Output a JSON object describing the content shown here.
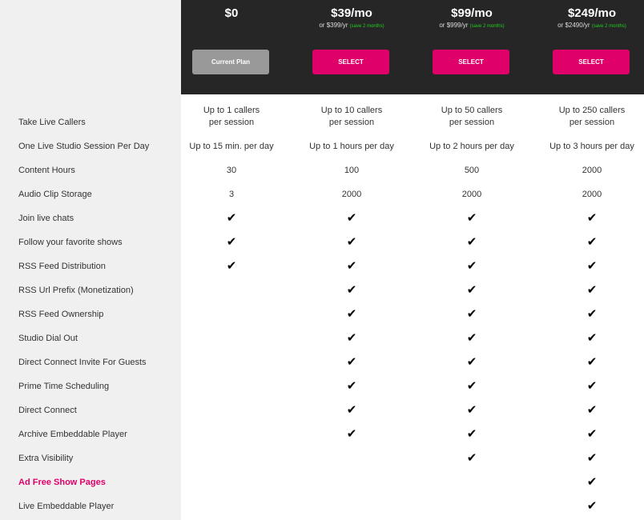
{
  "plans": [
    {
      "price": "$0",
      "yearly": "",
      "save": "",
      "button": "Current Plan",
      "current": true
    },
    {
      "price": "$39/mo",
      "yearly": "or $399/yr ",
      "save": "(save 2 months)",
      "button": "SELECT",
      "current": false
    },
    {
      "price": "$99/mo",
      "yearly": "or $999/yr ",
      "save": "(save 2 months)",
      "button": "SELECT",
      "current": false
    },
    {
      "price": "$249/mo",
      "yearly": "or $2490/yr ",
      "save": "(save 2 months)",
      "button": "SELECT",
      "current": false
    }
  ],
  "check_icon": "check-icon",
  "colors": {
    "accent": "#e0006a",
    "header_bg": "#262626",
    "save_text": "#22cc22",
    "current_btn": "#999999"
  },
  "features": [
    {
      "label": "Take Live Callers",
      "values": [
        [
          "Up to 1 callers",
          "per session"
        ],
        [
          "Up to 10 callers",
          "per session"
        ],
        [
          "Up to 50 callers",
          "per session"
        ],
        [
          "Up to 250 callers",
          "per session"
        ]
      ]
    },
    {
      "label": "One Live Studio Session Per Day",
      "values": [
        "Up to 15 min. per day",
        "Up to 1 hours per day",
        "Up to 2 hours per day",
        "Up to 3 hours per day"
      ]
    },
    {
      "label": "Content Hours",
      "values": [
        "30",
        "100",
        "500",
        "2000"
      ]
    },
    {
      "label": "Audio Clip Storage",
      "values": [
        "3",
        "2000",
        "2000",
        "2000"
      ]
    },
    {
      "label": "Join live chats",
      "values": [
        true,
        true,
        true,
        true
      ]
    },
    {
      "label": "Follow your favorite shows",
      "values": [
        true,
        true,
        true,
        true
      ]
    },
    {
      "label": "RSS Feed Distribution",
      "values": [
        true,
        true,
        true,
        true
      ]
    },
    {
      "label": "RSS Url Prefix (Monetization)",
      "values": [
        false,
        true,
        true,
        true
      ]
    },
    {
      "label": "RSS Feed Ownership",
      "values": [
        false,
        true,
        true,
        true
      ]
    },
    {
      "label": "Studio Dial Out",
      "values": [
        false,
        true,
        true,
        true
      ]
    },
    {
      "label": "Direct Connect Invite For Guests",
      "values": [
        false,
        true,
        true,
        true
      ]
    },
    {
      "label": "Prime Time Scheduling",
      "values": [
        false,
        true,
        true,
        true
      ]
    },
    {
      "label": "Direct Connect",
      "values": [
        false,
        true,
        true,
        true
      ]
    },
    {
      "label": "Archive Embeddable Player",
      "values": [
        false,
        true,
        true,
        true
      ]
    },
    {
      "label": "Extra Visibility",
      "values": [
        false,
        false,
        true,
        true
      ]
    },
    {
      "label": "Ad Free Show Pages",
      "values": [
        false,
        false,
        false,
        true
      ],
      "highlight": true
    },
    {
      "label": "Live Embeddable Player",
      "values": [
        false,
        false,
        false,
        true
      ]
    }
  ]
}
